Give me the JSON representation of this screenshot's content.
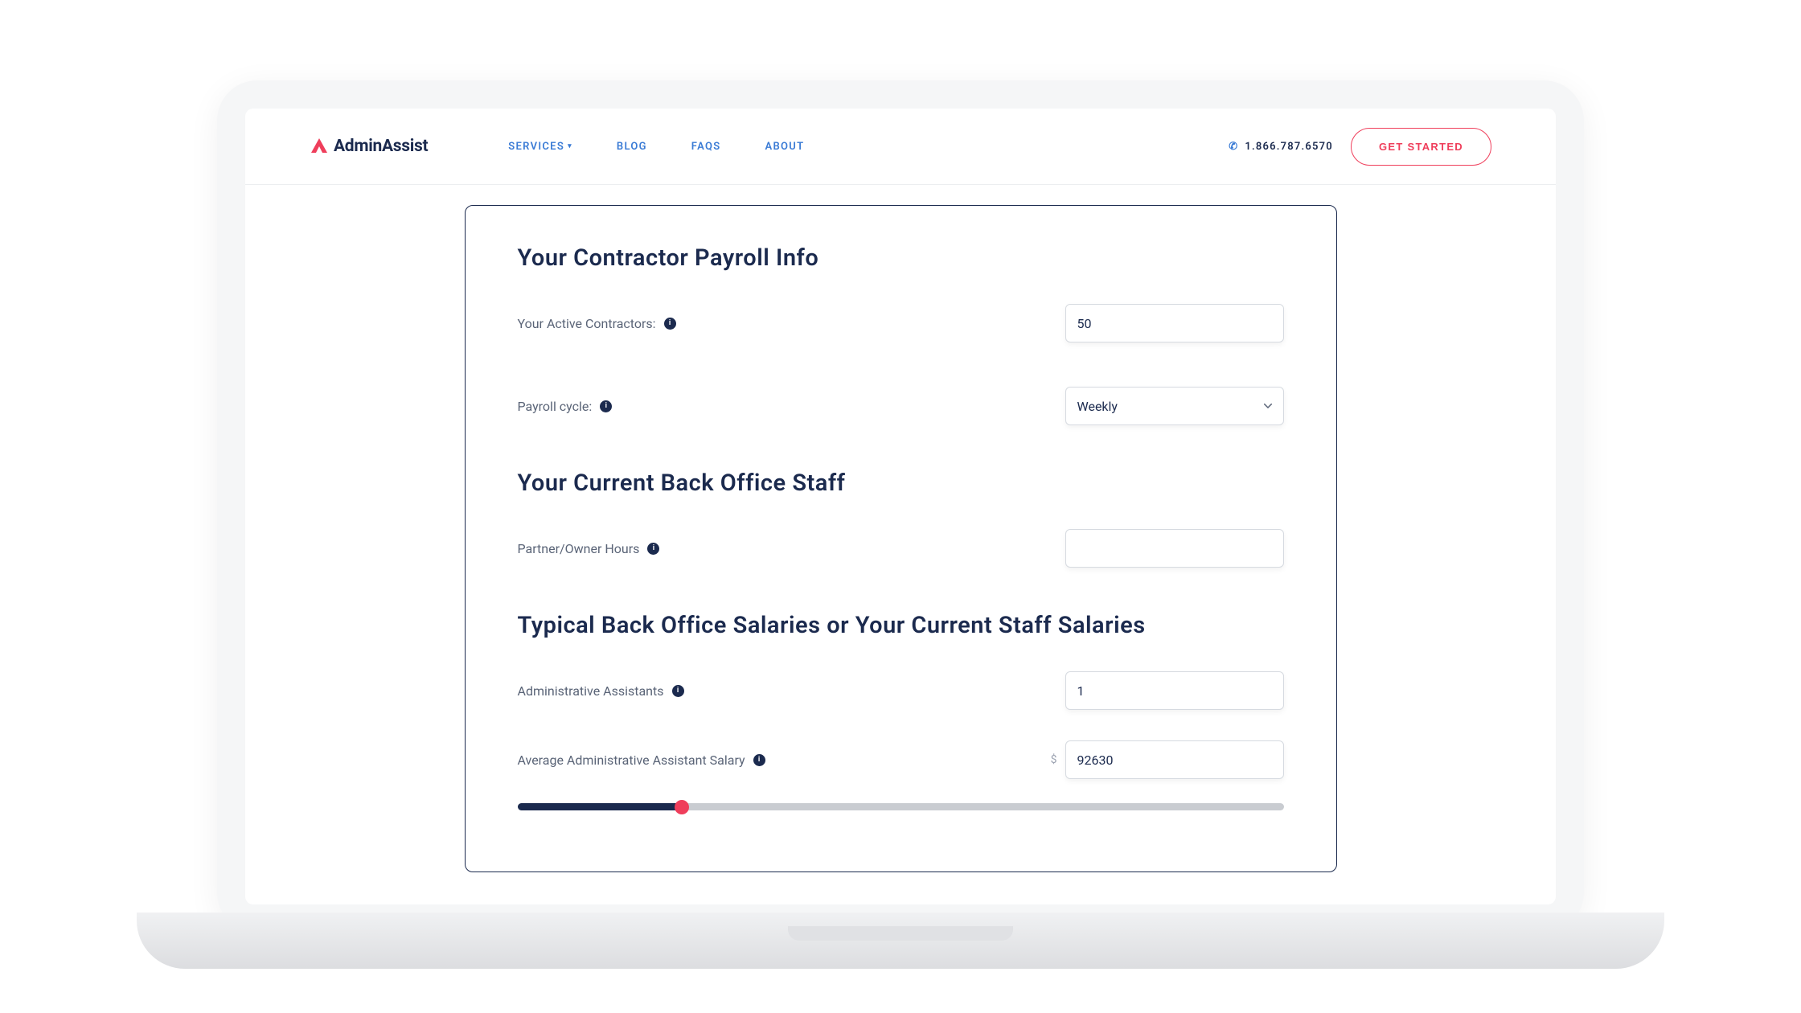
{
  "brand": {
    "name": "AdminAssist"
  },
  "nav": {
    "items": [
      {
        "label": "SERVICES",
        "has_dropdown": true
      },
      {
        "label": "BLOG"
      },
      {
        "label": "FAQS"
      },
      {
        "label": "ABOUT"
      }
    ]
  },
  "header": {
    "phone": "1.866.787.6570",
    "cta_label": "GET STARTED"
  },
  "form": {
    "section1_title": "Your Contractor Payroll Info",
    "active_contractors_label": "Your Active Contractors:",
    "active_contractors_value": "50",
    "payroll_cycle_label": "Payroll cycle:",
    "payroll_cycle_value": "Weekly",
    "section2_title": "Your Current Back Office Staff",
    "partner_hours_label": "Partner/Owner Hours",
    "partner_hours_value": "",
    "section3_title": "Typical Back Office Salaries or Your Current Staff Salaries",
    "admin_assistants_label": "Administrative Assistants",
    "admin_assistants_value": "1",
    "avg_salary_label": "Average Administrative Assistant Salary",
    "avg_salary_value": "92630",
    "currency_symbol": "$",
    "slider_percent": 21.5
  },
  "info_glyph": "i"
}
